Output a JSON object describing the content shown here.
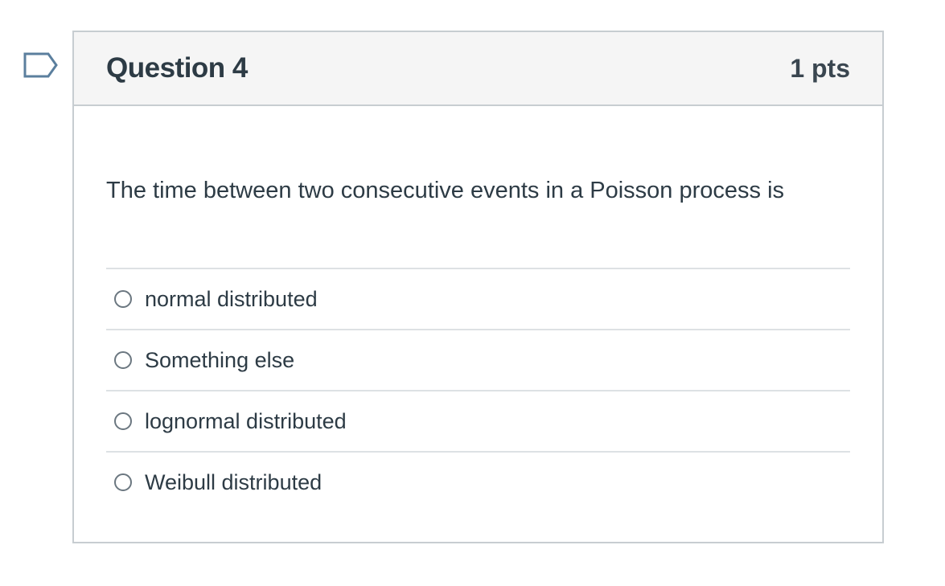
{
  "question": {
    "title": "Question 4",
    "points": "1 pts",
    "text": "The time between two consecutive events in a Poisson process is",
    "flag_icon": "bookmark-flag-icon",
    "answers": [
      {
        "label": "normal distributed",
        "selected": false
      },
      {
        "label": "Something else",
        "selected": false
      },
      {
        "label": "lognormal distributed",
        "selected": false
      },
      {
        "label": "Weibull distributed",
        "selected": false
      }
    ]
  },
  "colors": {
    "border": "#c7cdd1",
    "header_bg": "#f5f5f5",
    "text": "#2d3b45",
    "flag_stroke": "#5b7f9e"
  }
}
